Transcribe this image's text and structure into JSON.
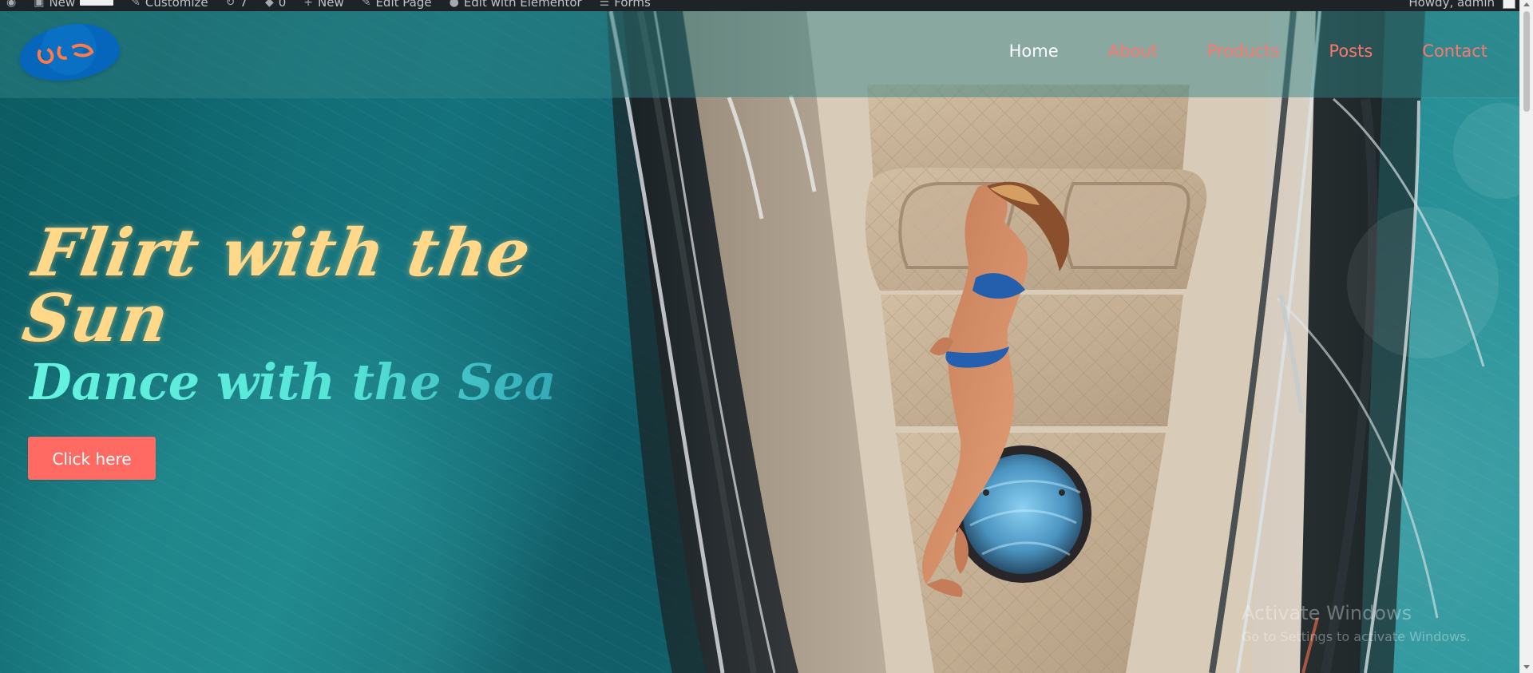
{
  "browser": {
    "scrollbar": {
      "label": "page-scrollbar"
    }
  },
  "admin_bar": {
    "items": [
      {
        "icon": "wordpress-icon",
        "label": ""
      },
      {
        "icon": "new-icon",
        "label": "New"
      },
      {
        "icon": "customize-icon",
        "label": "Customize"
      },
      {
        "icon": "updates-icon",
        "label": "7"
      },
      {
        "icon": "comments-icon",
        "label": "0"
      },
      {
        "icon": "plus-icon",
        "label": "New"
      },
      {
        "icon": "edit-icon",
        "label": "Edit Page"
      },
      {
        "icon": "elementor-icon",
        "label": "Edit with Elementor"
      },
      {
        "icon": "forms-icon",
        "label": "Forms"
      }
    ],
    "right": {
      "greeting": "Howdy, admin"
    }
  },
  "site": {
    "logo": {
      "alt": "logo"
    },
    "nav": {
      "items": [
        {
          "label": "Home",
          "active": true
        },
        {
          "label": "About",
          "active": false
        },
        {
          "label": "Products",
          "active": false
        },
        {
          "label": "Posts",
          "active": false
        },
        {
          "label": "Contact",
          "active": false
        }
      ]
    }
  },
  "hero": {
    "headline": "Flirt with the Sun",
    "subheadline": "Dance with the Sea",
    "cta_label": "Click here",
    "background_scene": "aerial-boat-sea-image"
  },
  "overlay": {
    "windows_activation_title": "Activate Windows",
    "windows_activation_subtitle": "Go to Settings to activate Windows."
  },
  "colors": {
    "admin_bar": "#1d2327",
    "nav_active": "#ffffff",
    "nav_link": "#ff756b",
    "headline": "#ffd88a",
    "subheadline": "#49ead8",
    "cta": "#ff6b63",
    "logo_blue": "#0a70c4"
  }
}
